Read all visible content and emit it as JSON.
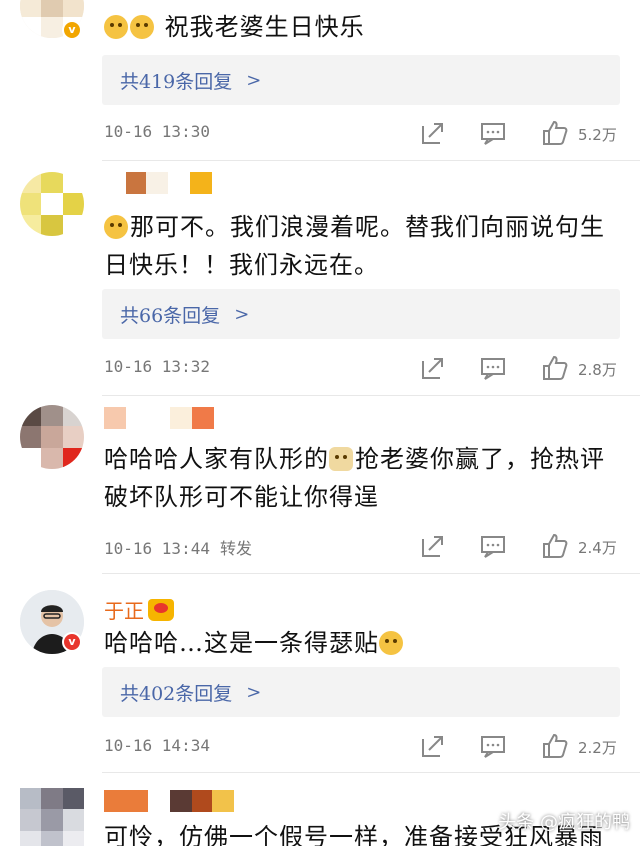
{
  "comments": [
    {
      "text": "祝我老婆生日快乐",
      "replies": "共419条回复",
      "time": "10-16 13:30",
      "likes": "5.2万"
    },
    {
      "text": "那可不。我们浪漫着呢。替我们向丽说句生日快乐！！我们永远在。",
      "replies": "共66条回复",
      "time": "10-16 13:32",
      "likes": "2.8万"
    },
    {
      "text_a": "哈哈哈人家有队形的",
      "text_b": "抢老婆你赢了，抢热评破坏队形可不能让你得逞",
      "time": "10-16 13:44",
      "forward": "转发",
      "likes": "2.4万"
    },
    {
      "name": "于正",
      "text": "哈哈哈…这是一条得瑟贴",
      "replies": "共402条回复",
      "time": "10-16 14:34",
      "likes": "2.2万"
    },
    {
      "text": "可怜，仿佛一个假号一样，准备接受狂风暴雨"
    }
  ],
  "watermark": "头条 @疯狂的鸭",
  "colors": {
    "link": "#4a67a8",
    "name": "#e86a1c",
    "reply_bg": "#f3f3f3"
  }
}
